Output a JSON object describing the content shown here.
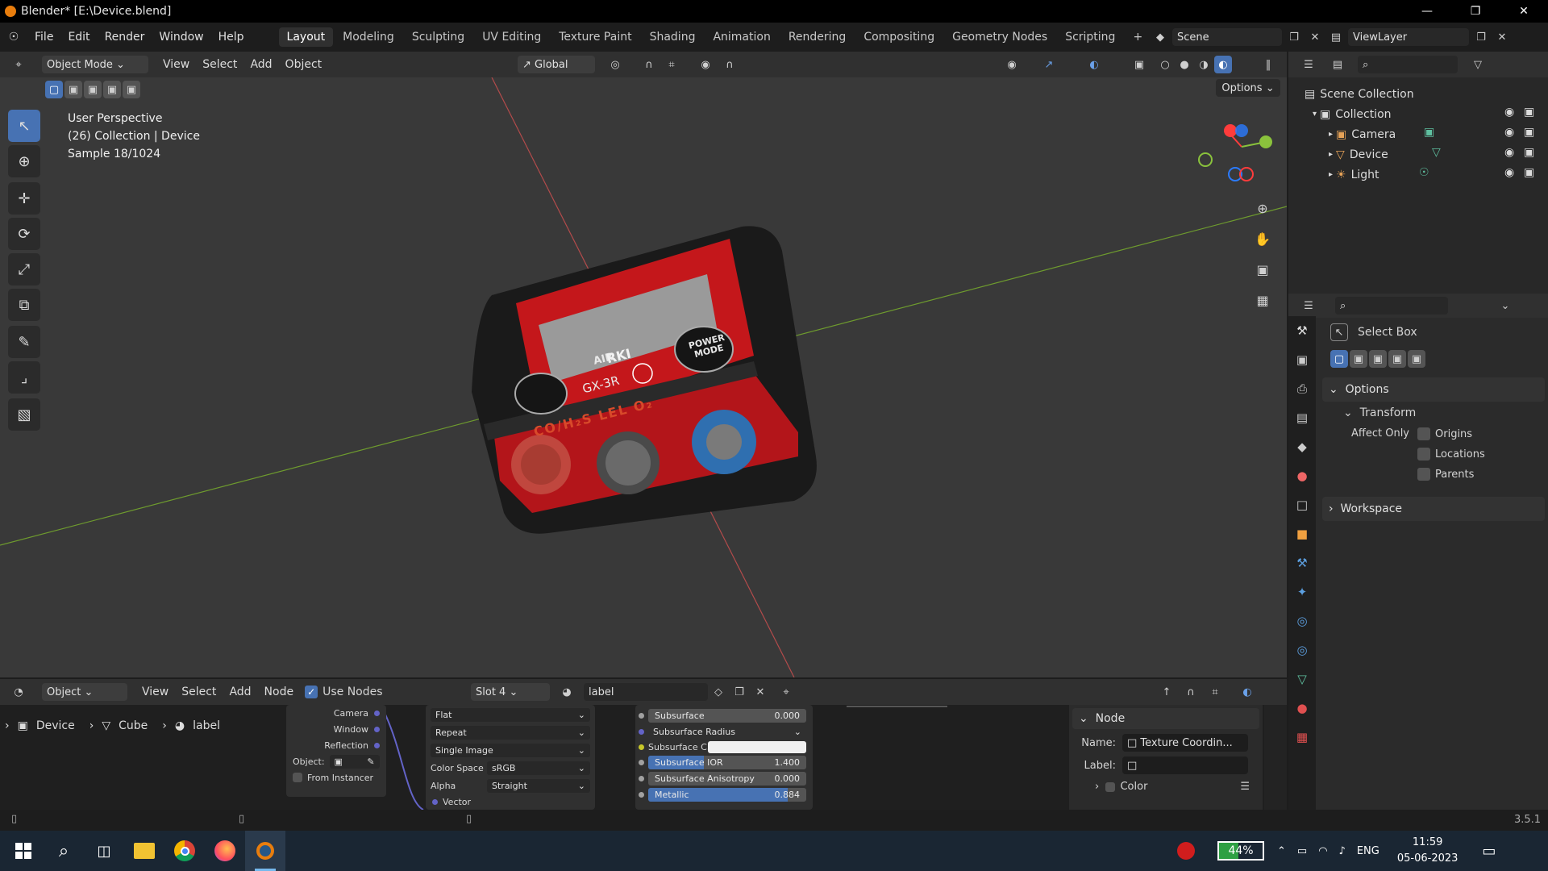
{
  "window": {
    "title": "Blender* [E:\\Device.blend]",
    "controls": [
      "minimize-icon",
      "restore-icon",
      "close-icon"
    ]
  },
  "menu": {
    "items": [
      "File",
      "Edit",
      "Render",
      "Window",
      "Help"
    ]
  },
  "workspaces": {
    "tabs": [
      "Layout",
      "Modeling",
      "Sculpting",
      "UV Editing",
      "Texture Paint",
      "Shading",
      "Animation",
      "Rendering",
      "Compositing",
      "Geometry Nodes",
      "Scripting"
    ],
    "active": "Layout",
    "add_icon": "+"
  },
  "scene": {
    "name": "Scene",
    "view_layer": "ViewLayer"
  },
  "viewport_header": {
    "mode": "Object Mode",
    "menus": [
      "View",
      "Select",
      "Add",
      "Object"
    ],
    "orientation": "Global",
    "options": "Options"
  },
  "viewport": {
    "overlay_lines": [
      "User Perspective",
      "(26) Collection | Device",
      "Sample 18/1024"
    ],
    "gizmo_axes": [
      "X",
      "Y",
      "Z"
    ],
    "device_labels": {
      "brand": "RKI",
      "model": "GX-3R",
      "button_air": "AIR",
      "button_power": "POWER MODE",
      "gas_strip": "CO/H₂S  LEL  O₂"
    },
    "colors": {
      "bg": "#393939",
      "axis_x": "#b34b4b",
      "axis_y": "#6e9b2e",
      "device": "#c4171b",
      "bumper": "#1a1a1a"
    }
  },
  "outliner": {
    "root": "Scene Collection",
    "collection": "Collection",
    "objects": [
      {
        "name": "Camera",
        "icon": "camera-icon"
      },
      {
        "name": "Device",
        "icon": "mesh-icon"
      },
      {
        "name": "Light",
        "icon": "light-icon"
      }
    ]
  },
  "properties": {
    "tool_name": "Select Box",
    "options_header": "Options",
    "transform_header": "Transform",
    "affect_only_label": "Affect Only",
    "checkboxes": [
      "Origins",
      "Locations",
      "Parents"
    ],
    "workspace_header": "Workspace"
  },
  "node_editor": {
    "header": {
      "object_dropdown": "Object",
      "menus": [
        "View",
        "Select",
        "Add",
        "Node"
      ],
      "use_nodes_label": "Use Nodes",
      "slot": "Slot 4",
      "material": "label"
    },
    "breadcrumb": [
      "Device",
      "Cube",
      "label"
    ],
    "texcoord_outputs": [
      "Camera",
      "Window",
      "Reflection"
    ],
    "object_label": "Object:",
    "from_instancer": "From Instancer",
    "image_node": {
      "projection": "Flat",
      "extension": "Repeat",
      "source": "Single Image",
      "color_space_label": "Color Space",
      "color_space": "sRGB",
      "alpha_label": "Alpha",
      "alpha": "Straight",
      "vector_label": "Vector"
    },
    "bsdf_rows": [
      {
        "label": "Subsurface",
        "value": "0.000",
        "fill": 0
      },
      {
        "label": "Subsurface Radius",
        "value": "",
        "fill": 0
      },
      {
        "label": "Subsurface C...",
        "value": "",
        "fill": 0
      },
      {
        "label": "Subsurface IOR",
        "value": "1.400",
        "fill": 0.35
      },
      {
        "label": "Subsurface Anisotropy",
        "value": "0.000",
        "fill": 0
      },
      {
        "label": "Metallic",
        "value": "0.884",
        "fill": 0.884
      }
    ],
    "sidebar": {
      "panel": "Node",
      "name_label": "Name:",
      "name_value": "Texture Coordin...",
      "label_label": "Label:",
      "label_value": "",
      "color_label": "Color"
    }
  },
  "status": {
    "version": "3.5.1"
  },
  "taskbar": {
    "apps": [
      "start-icon",
      "search-icon",
      "task-view-icon",
      "file-explorer-icon",
      "chrome-icon",
      "firefox-icon",
      "blender-icon"
    ],
    "battery": "44%",
    "language": "ENG",
    "time": "11:59",
    "date": "05-06-2023"
  }
}
